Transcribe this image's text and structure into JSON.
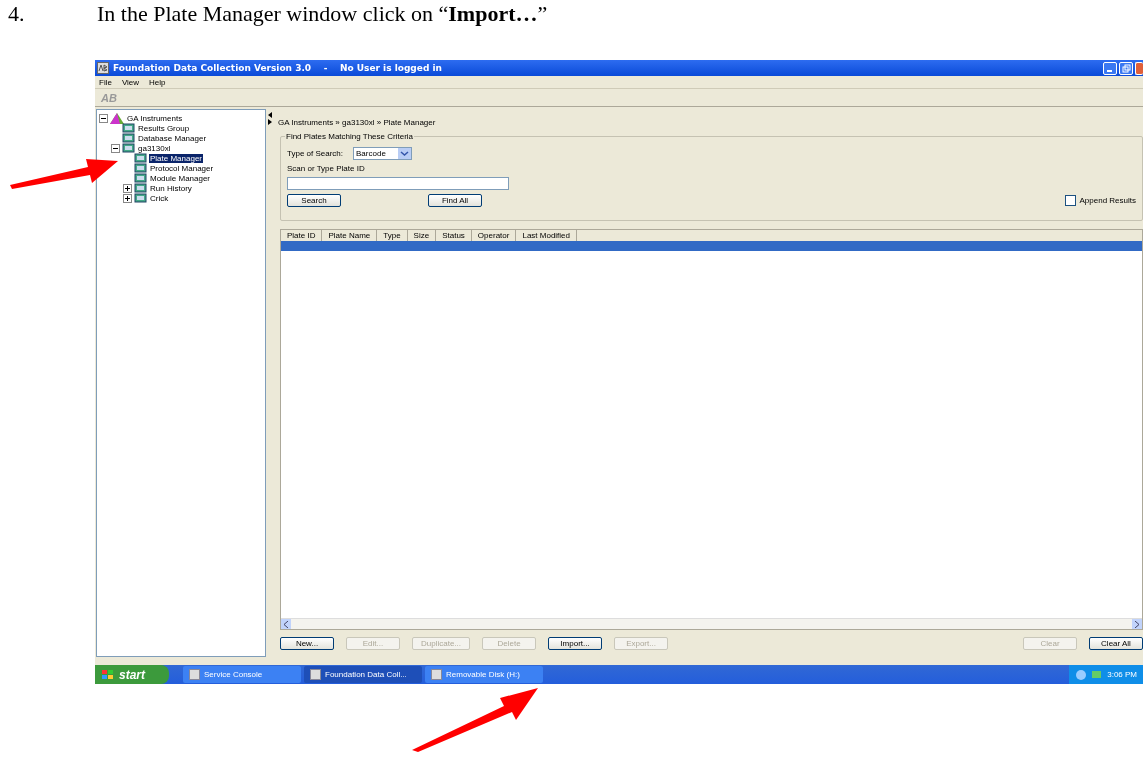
{
  "document": {
    "step_number": "4.",
    "instruction": "In the Plate Manager window click on “**Import…**”"
  },
  "window": {
    "title": "Foundation Data Collection Version 3.0    -    No User is logged in"
  },
  "menu": [
    "File",
    "View",
    "Help"
  ],
  "toolbar": {
    "logo": "AB"
  },
  "tree": [
    {
      "label": "GA Instruments",
      "expanded": true,
      "selected": false,
      "children": [
        {
          "label": "Results Group",
          "selected": false
        },
        {
          "label": "Database Manager",
          "selected": false
        },
        {
          "label": "ga3130xl",
          "expanded": true,
          "selected": false,
          "children": [
            {
              "label": "Plate Manager",
              "selected": true
            },
            {
              "label": "Protocol Manager",
              "selected": false
            },
            {
              "label": "Module Manager",
              "selected": false
            },
            {
              "label": "Run History",
              "expanded": false,
              "selected": false
            },
            {
              "label": "Crick",
              "expanded": false,
              "selected": false
            }
          ]
        }
      ]
    }
  ],
  "breadcrumb": "GA Instruments » ga3130xl » Plate Manager",
  "criteria": {
    "title": "Find Plates Matching These Criteria",
    "type_label": "Type of Search:",
    "type_value": "Barcode",
    "scan_label": "Scan or Type Plate ID",
    "buttons": [
      "Search",
      "Find All"
    ],
    "append": {
      "label": "Append Results",
      "checked": false
    }
  },
  "table": {
    "columns": [
      "Plate ID",
      "Plate Name",
      "Type",
      "Size",
      "Status",
      "Operator",
      "Last Modified"
    ],
    "rows": [
      {
        "selected": true
      }
    ]
  },
  "actions": [
    {
      "label": "New...",
      "disabled": false
    },
    {
      "label": "Edit...",
      "disabled": true
    },
    {
      "label": "Duplicate...",
      "disabled": true
    },
    {
      "label": "Delete",
      "disabled": true
    },
    {
      "label": "Import...",
      "disabled": false
    },
    {
      "label": "Export...",
      "disabled": true
    }
  ],
  "right_actions": [
    {
      "label": "Clear",
      "disabled": true
    },
    {
      "label": "Clear All",
      "disabled": false
    }
  ],
  "taskbar": {
    "start": "start",
    "items": [
      {
        "label": "Service Console",
        "selected": false
      },
      {
        "label": "Foundation Data Coll...",
        "selected": true
      },
      {
        "label": "Removable Disk (H:)",
        "selected": false
      }
    ],
    "time": "3:06 PM"
  }
}
